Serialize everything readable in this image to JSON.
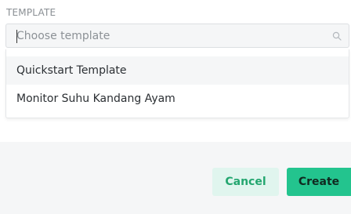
{
  "template_section": {
    "label": "TEMPLATE",
    "search": {
      "placeholder": "Choose template",
      "value": "",
      "icon": "search-icon"
    },
    "options": [
      {
        "label": "Quickstart Template",
        "highlighted": true
      },
      {
        "label": "Monitor Suhu Kandang Ayam",
        "highlighted": false
      }
    ]
  },
  "footer": {
    "cancel_label": "Cancel",
    "create_label": "Create"
  },
  "colors": {
    "accent": "#23c48e",
    "accent_light": "#e0f5ee",
    "accent_text": "#23a66f"
  }
}
